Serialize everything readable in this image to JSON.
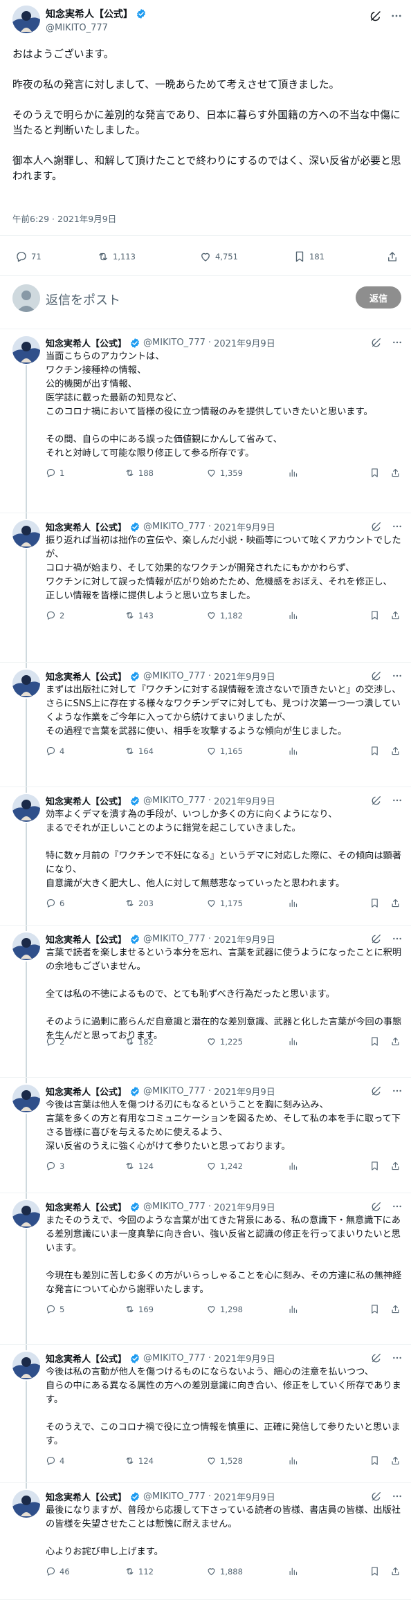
{
  "main_post": {
    "author_name": "知念実希人【公式】",
    "handle": "@MIKITO_777",
    "body": "おはようございます。\n\n昨夜の私の発言に対しまして、一晩あらためて考えさせて頂きました。\n\nそのうえで明らかに差別的な発言であり、日本に暮らす外国籍の方への不当な中傷に当たると判断いたしました。\n\n御本人へ謝罪し、和解して頂けたことで終わりにするのではく、深い反省が必要と思われます。",
    "timestamp": "午前6:29 · 2021年9月9日",
    "stats": {
      "replies": "71",
      "reposts": "1,113",
      "likes": "4,751",
      "bookmarks": "181"
    }
  },
  "reply_box": {
    "placeholder": "返信をポスト",
    "button_label": "返信"
  },
  "thread": [
    {
      "author_name": "知念実希人【公式】",
      "handle": "@MIKITO_777",
      "separator": "·",
      "date": "2021年9月9日",
      "body": "当面こちらのアカウントは、\nワクチン接種枠の情報、\n公的機関が出す情報、\n医学誌に載った最新の知見など、\nこのコロナ禍において皆様の役に立つ情報のみを提供していきたいと思います。\n\nその間、自らの中にある誤った価値観にかんして省みて、\nそれと対峙して可能な限り修正して参る所存です。",
      "replies": "1",
      "reposts": "188",
      "likes": "1,359"
    },
    {
      "author_name": "知念実希人【公式】",
      "handle": "@MIKITO_777",
      "separator": "·",
      "date": "2021年9月9日",
      "body": "振り返れば当初は拙作の宣伝や、楽しんだ小説・映画等について呟くアカウントでしたが、\nコロナ禍が始まり、そして効果的なワクチンが開発されたにもかかわらず、\nワクチンに対して誤った情報が広がり始めたため、危機感をおぼえ、それを修正し、\n正しい情報を皆様に提供しようと思い立ちました。",
      "replies": "2",
      "reposts": "143",
      "likes": "1,182"
    },
    {
      "author_name": "知念実希人【公式】",
      "handle": "@MIKITO_777",
      "separator": "·",
      "date": "2021年9月9日",
      "body": "まずは出版社に対して『ワクチンに対する誤情報を流さないで頂きたいと』の交渉し、\nさらにSNS上に存在する様々なワクチンデマに対しても、見つけ次第一つ一つ潰していくような作業をご今年に入ってから続けてまいりましたが、\nその過程で言葉を武器に使い、相手を攻撃するような傾向が生じました。",
      "replies": "4",
      "reposts": "164",
      "likes": "1,165"
    },
    {
      "author_name": "知念実希人【公式】",
      "handle": "@MIKITO_777",
      "separator": "·",
      "date": "2021年9月9日",
      "body": "効率よくデマを潰す為の手段が、いつしか多くの方に向くようになり、\nまるでそれが正しいことのように錯覚を起こしていきました。\n\n特に数ヶ月前の『ワクチンで不妊になる』というデマに対応した際に、その傾向は顕著になり、\n自意識が大きく肥大し、他人に対して無慈悲なっていったと思われます。",
      "replies": "6",
      "reposts": "203",
      "likes": "1,175"
    },
    {
      "author_name": "知念実希人【公式】",
      "handle": "@MIKITO_777",
      "separator": "·",
      "date": "2021年9月9日",
      "body": "言葉で読者を楽しませるという本分を忘れ、言葉を武器に使うようになったことに釈明の余地もございません。\n\n全ては私の不徳によるもので、とても恥ずべき行為だったと思います。\n\nそのように過剰に膨らんだ自意識と潜在的な差別意識、武器と化した言葉が今回の事態を生んだと思っております。",
      "replies": "2",
      "reposts": "182",
      "likes": "1,225"
    },
    {
      "author_name": "知念実希人【公式】",
      "handle": "@MIKITO_777",
      "separator": "·",
      "date": "2021年9月9日",
      "body": "今後は言葉は他人を傷つける刃にもなるということを胸に刻み込み、\n言葉を多くの方と有用なコミュニケーションを図るため、そして私の本を手に取って下さる皆様に喜びを与えるために使えるよう、\n深い反省のうえに強く心がけて参りたいと思っております。",
      "replies": "3",
      "reposts": "124",
      "likes": "1,242"
    },
    {
      "author_name": "知念実希人【公式】",
      "handle": "@MIKITO_777",
      "separator": "·",
      "date": "2021年9月9日",
      "body": "またそのうえで、今回のような言葉が出てきた背景にある、私の意識下・無意識下にある差別意識にいま一度真摯に向き合い、強い反省と認識の修正を行ってまいりたいと思います。\n\n今現在も差別に苦しむ多くの方がいらっしゃることを心に刻み、その方達に私の無神経な発言について心から謝罪いたします。",
      "replies": "5",
      "reposts": "169",
      "likes": "1,298"
    },
    {
      "author_name": "知念実希人【公式】",
      "handle": "@MIKITO_777",
      "separator": "·",
      "date": "2021年9月9日",
      "body": "今後は私の言動が他人を傷つけるものにならないよう、細心の注意を払いつつ、\n自らの中にある異なる属性の方への差別意識に向き合い、修正をしていく所存であります。\n\nそのうえで、このコロナ禍で役に立つ情報を慎重に、正確に発信して参りたいと思います。",
      "replies": "4",
      "reposts": "124",
      "likes": "1,528"
    },
    {
      "author_name": "知念実希人【公式】",
      "handle": "@MIKITO_777",
      "separator": "·",
      "date": "2021年9月9日",
      "body": "最後になりますが、普段から応援して下さっている読者の皆様、書店員の皆様、出版社の皆様を失望させたことは慙愧に耐えません。\n\n心よりお詫び申し上げます。",
      "replies": "46",
      "reposts": "112",
      "likes": "1,888"
    }
  ],
  "icons": {
    "verified": "verified-badge-icon",
    "grok": "grok-icon",
    "more": "more-icon",
    "reply": "reply-icon",
    "repost": "repost-icon",
    "like": "like-icon",
    "views": "views-icon",
    "bookmark": "bookmark-icon",
    "share": "share-icon"
  },
  "colors": {
    "verified": "#1d9bf0",
    "text": "#0f1419",
    "secondary": "#536471",
    "reply_button": "#8e8e8e"
  }
}
